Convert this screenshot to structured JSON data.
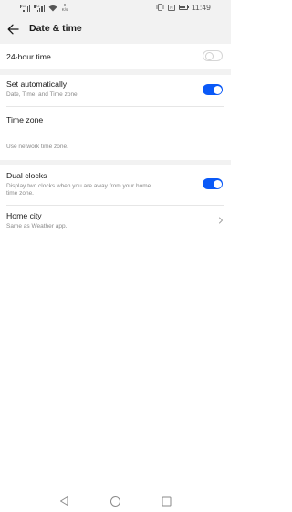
{
  "status_bar": {
    "signal_1_label": "4G",
    "signal_2_label": "4G",
    "net_speed_value": "0",
    "net_speed_unit": "K/s",
    "nfc_label": "N",
    "battery_level": 0.8,
    "time": "11:49"
  },
  "header": {
    "title": "Date & time"
  },
  "settings": {
    "hour_24": {
      "label": "24-hour time",
      "enabled": false
    },
    "set_automatically": {
      "label": "Set automatically",
      "description": "Date, Time, and Time zone",
      "enabled": true
    },
    "time_zone": {
      "label": "Time zone",
      "note": "Use network time zone."
    },
    "dual_clocks": {
      "label": "Dual clocks",
      "description_line1": "Display two clocks when you are away from your home",
      "description_line2": "time zone.",
      "enabled": true
    },
    "home_city": {
      "label": "Home city",
      "description": "Same as Weather app."
    }
  },
  "colors": {
    "accent": "#0a59f7",
    "section_background": "#f2f2f2",
    "secondary_text": "#8a8a8a"
  },
  "icons": {
    "back": "arrow-left-icon",
    "chevron": "chevron-right-icon",
    "nav_back": "triangle-back-icon",
    "nav_home": "circle-home-icon",
    "nav_recents": "square-recents-icon"
  }
}
